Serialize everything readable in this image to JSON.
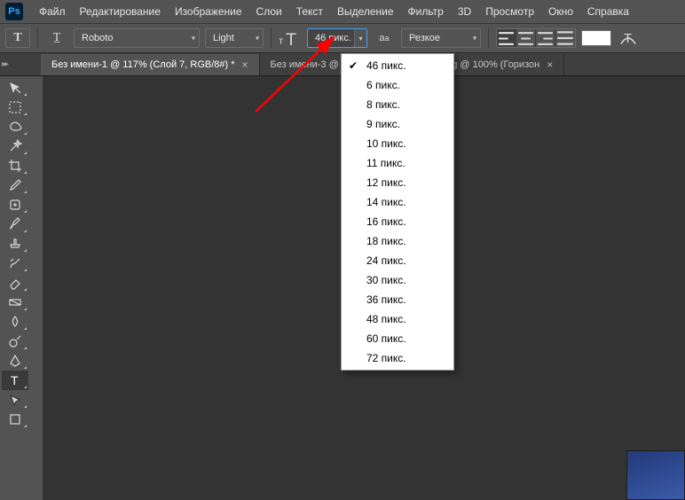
{
  "app": {
    "logo": "Ps"
  },
  "menu": {
    "items": [
      "Файл",
      "Редактирование",
      "Изображение",
      "Слои",
      "Текст",
      "Выделение",
      "Фильтр",
      "3D",
      "Просмотр",
      "Окно",
      "Справка"
    ]
  },
  "options": {
    "font": "Roboto",
    "weight": "Light",
    "size": "46 пикс.",
    "aa_label": "Резкое"
  },
  "tabs": {
    "items": [
      {
        "title": "Без имени-1 @ 117% (Слой 7, RGB/8#) *",
        "active": true
      },
      {
        "title": "Без имени-3 @",
        "active": false,
        "clipped": true
      },
      {
        "title": "hdfon.ru-447579140.jpg @ 100% (Горизон",
        "active": false
      }
    ]
  },
  "size_menu": {
    "selected": "46 пикс.",
    "items": [
      "46 пикс.",
      "6 пикс.",
      "8 пикс.",
      "9 пикс.",
      "10 пикс.",
      "11 пикс.",
      "12 пикс.",
      "14 пикс.",
      "16 пикс.",
      "18 пикс.",
      "24 пикс.",
      "30 пикс.",
      "36 пикс.",
      "48 пикс.",
      "60 пикс.",
      "72 пикс."
    ]
  }
}
